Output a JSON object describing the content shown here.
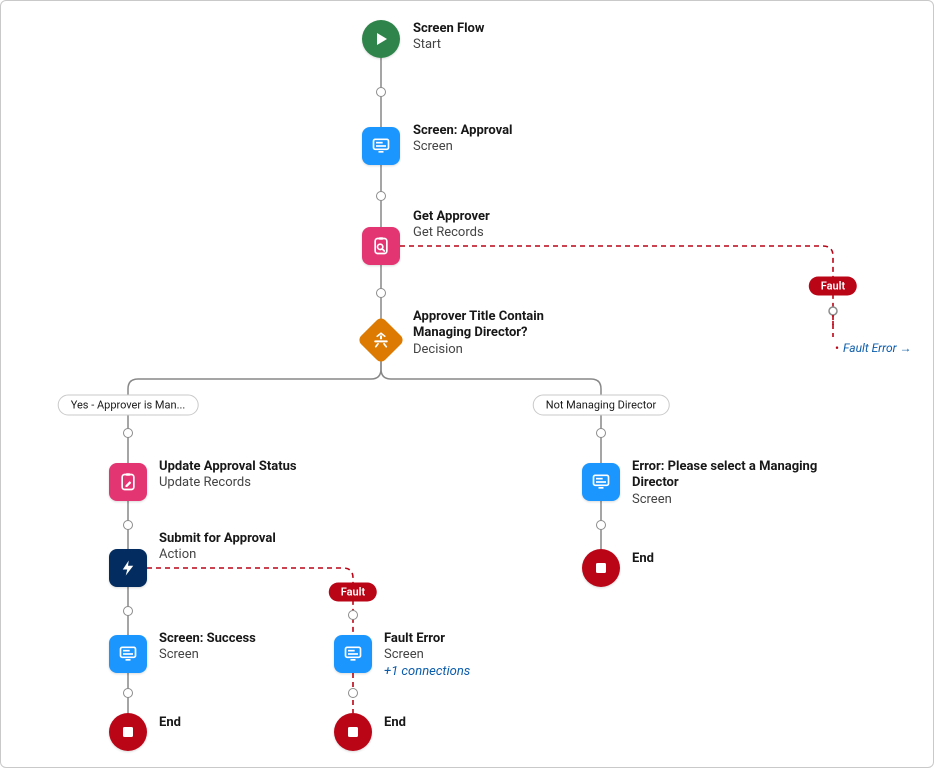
{
  "nodes": {
    "start": {
      "title": "Screen Flow",
      "sub": "Start"
    },
    "screenApproval": {
      "title": "Screen: Approval",
      "sub": "Screen"
    },
    "getApprover": {
      "title": "Get Approver",
      "sub": "Get Records"
    },
    "decision": {
      "title": "Approver Title Contain\nManaging Director?",
      "sub": "Decision"
    },
    "updateStatus": {
      "title": "Update Approval Status",
      "sub": "Update Records"
    },
    "submit": {
      "title": "Submit for Approval",
      "sub": "Action"
    },
    "screenSuccess": {
      "title": "Screen: Success",
      "sub": "Screen"
    },
    "faultError": {
      "title": "Fault Error",
      "sub": "Screen",
      "extra": "+1 connections"
    },
    "errorScreen": {
      "title": "Error: Please select a Managing\nDirector",
      "sub": "Screen"
    },
    "end1": {
      "title": "End"
    },
    "end2": {
      "title": "End"
    },
    "end3": {
      "title": "End"
    }
  },
  "branches": {
    "yes": "Yes - Approver is Man...",
    "no": "Not Managing Director"
  },
  "fault": "Fault",
  "gotoFaultError": "Fault Error"
}
